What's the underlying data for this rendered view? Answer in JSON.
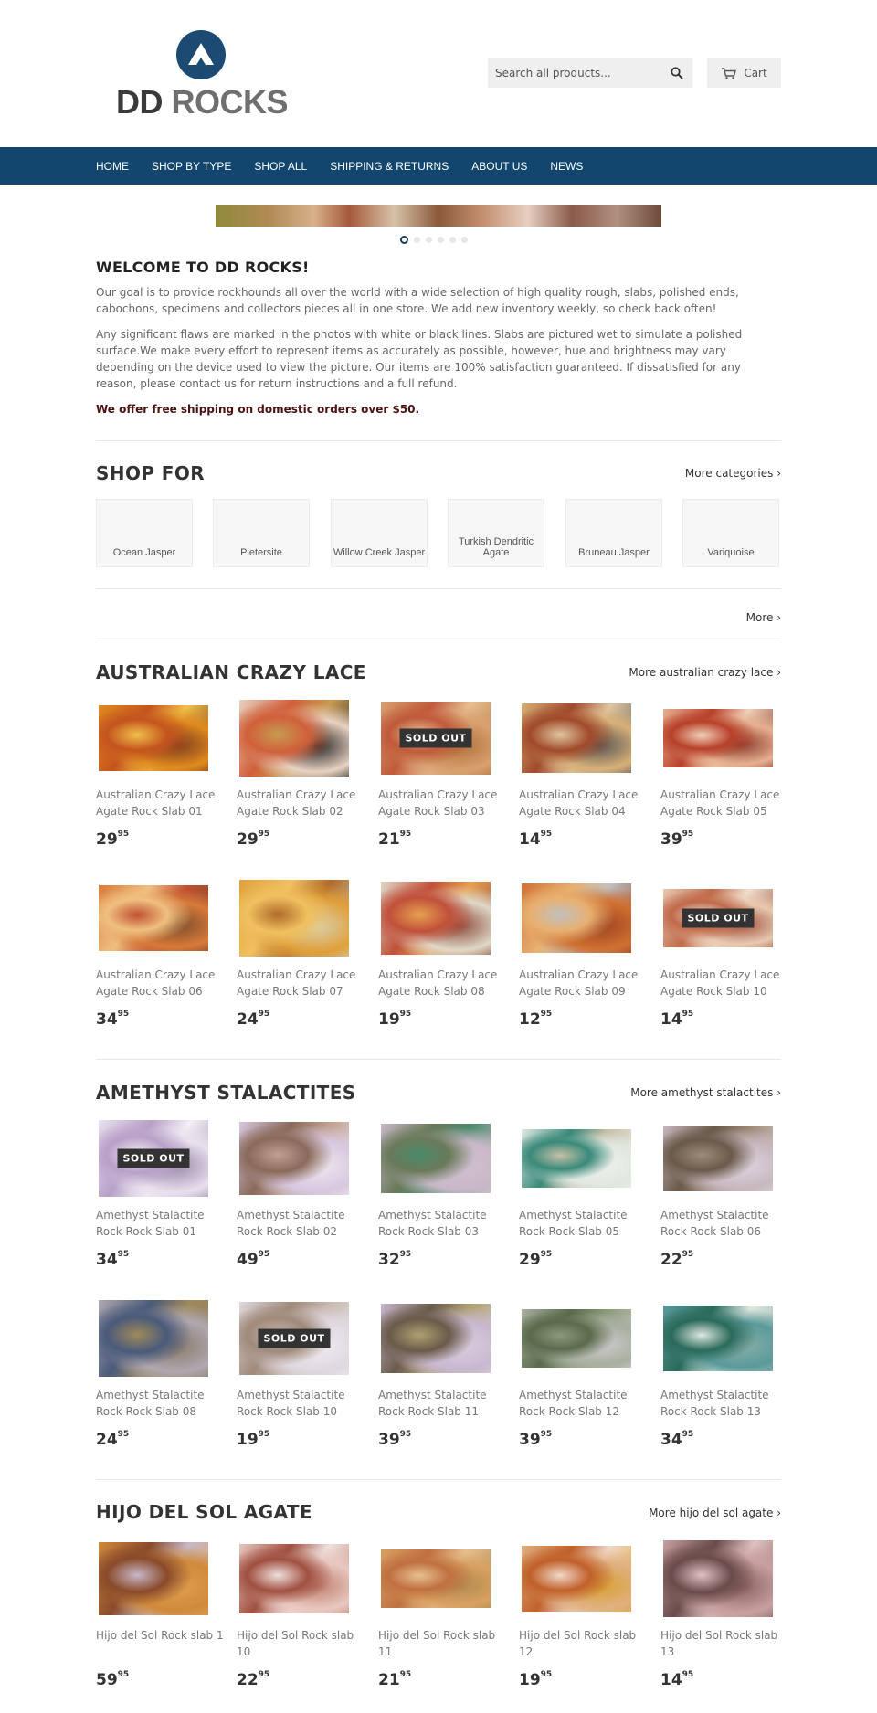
{
  "header": {
    "logo_dd": "DD",
    "logo_rocks": "ROCKS",
    "search_placeholder": "Search all products...",
    "cart_label": "Cart"
  },
  "nav": [
    "HOME",
    "SHOP BY TYPE",
    "SHOP ALL",
    "SHIPPING & RETURNS",
    "ABOUT US",
    "NEWS"
  ],
  "slideshow": {
    "slides": 6,
    "active": 1
  },
  "welcome": {
    "title": "WELCOME TO DD ROCKS!",
    "p1": "Our goal is to provide rockhounds all over the world with a wide selection of high quality rough, slabs, polished ends, cabochons, specimens and collectors pieces all in one store.  We add new inventory weekly, so check back often!",
    "p2": "Any significant flaws are marked in the photos with white or black lines. Slabs are pictured wet to simulate a polished surface.We make every effort to represent items as accurately as possible, however, hue and brightness may vary depending on the device used to view the picture. Our items are 100% satisfaction guaranteed. If dissatisfied for any reason, please contact us for return instructions and a full refund.",
    "free_shipping": "We offer free shipping on domestic orders over $50."
  },
  "shop_for": {
    "title": "SHOP FOR",
    "more": "More categories ›",
    "categories": [
      "Ocean Jasper",
      "Pietersite",
      "Willow Creek Jasper",
      "Turkish Dendritic Agate",
      "Bruneau Jasper",
      "Variquoise"
    ],
    "more_bottom": "More ›"
  },
  "sold_out_label": "SOLD OUT",
  "sections": [
    {
      "title": "AUSTRALIAN CRAZY LACE",
      "more": "More australian crazy lace ›",
      "products": [
        {
          "name": "Australian Crazy Lace Agate Rock Slab 01",
          "dollars": "29",
          "cents": "95",
          "sold_out": false,
          "colors": [
            "#e08a1e",
            "#c4541e",
            "#f0c04a",
            "#7a3a1e"
          ]
        },
        {
          "name": "Australian Crazy Lace Agate Rock Slab 02",
          "dollars": "29",
          "cents": "95",
          "sold_out": false,
          "colors": [
            "#e8d2c2",
            "#d0603a",
            "#c89a50",
            "#222222"
          ]
        },
        {
          "name": "Australian Crazy Lace Agate Rock Slab 03",
          "dollars": "21",
          "cents": "95",
          "sold_out": true,
          "colors": [
            "#d8a070",
            "#c05a3a",
            "#e8c090",
            "#b0703a"
          ]
        },
        {
          "name": "Australian Crazy Lace Agate Rock Slab 04",
          "dollars": "14",
          "cents": "95",
          "sold_out": false,
          "colors": [
            "#d8b078",
            "#a04a2a",
            "#e0c6a0",
            "#555555"
          ]
        },
        {
          "name": "Australian Crazy Lace Agate Rock Slab 05",
          "dollars": "39",
          "cents": "95",
          "sold_out": false,
          "colors": [
            "#e6b090",
            "#b8402a",
            "#f0d0b8",
            "#8a3a2a"
          ]
        },
        {
          "name": "Australian Crazy Lace Agate Rock Slab 06",
          "dollars": "34",
          "cents": "95",
          "sold_out": false,
          "colors": [
            "#d87a3a",
            "#f0c080",
            "#c05030",
            "#7a4a2a"
          ]
        },
        {
          "name": "Australian Crazy Lace Agate Rock Slab 07",
          "dollars": "24",
          "cents": "95",
          "sold_out": false,
          "colors": [
            "#e0a03a",
            "#f0c060",
            "#b06a2a",
            "#d8d0b0"
          ]
        },
        {
          "name": "Australian Crazy Lace Agate Rock Slab 08",
          "dollars": "19",
          "cents": "95",
          "sold_out": false,
          "colors": [
            "#e0d8c8",
            "#c0503a",
            "#e8a050",
            "#8a4a3a"
          ]
        },
        {
          "name": "Australian Crazy Lace Agate Rock Slab 09",
          "dollars": "12",
          "cents": "95",
          "sold_out": false,
          "colors": [
            "#d07030",
            "#e8b070",
            "#c0c0c0",
            "#9a4020"
          ]
        },
        {
          "name": "Australian Crazy Lace Agate Rock Slab 10",
          "dollars": "14",
          "cents": "95",
          "sold_out": true,
          "colors": [
            "#e8c8b0",
            "#c06a4a",
            "#f0e0d0",
            "#a0503a"
          ]
        }
      ]
    },
    {
      "title": "AMETHYST STALACTITES",
      "more": "More amethyst stalactites ›",
      "products": [
        {
          "name": "Amethyst Stalactite Rock Rock Slab 01",
          "dollars": "34",
          "cents": "95",
          "sold_out": true,
          "colors": [
            "#e8e0ee",
            "#b8a0c8",
            "#f4f0f6",
            "#9a88aa"
          ]
        },
        {
          "name": "Amethyst Stalactite Rock Rock Slab 02",
          "dollars": "49",
          "cents": "95",
          "sold_out": false,
          "colors": [
            "#d8c8e0",
            "#8a6a5a",
            "#c0a090",
            "#f0e8f0"
          ]
        },
        {
          "name": "Amethyst Stalactite Rock Rock Slab 03",
          "dollars": "32",
          "cents": "95",
          "sold_out": false,
          "colors": [
            "#c8b8c8",
            "#6a7a5a",
            "#4a8a6a",
            "#d0c0d0"
          ]
        },
        {
          "name": "Amethyst Stalactite Rock Rock Slab 05",
          "dollars": "29",
          "cents": "95",
          "sold_out": false,
          "colors": [
            "#e0e8e0",
            "#3a8a7a",
            "#c8c0a8",
            "#f0f0ec"
          ]
        },
        {
          "name": "Amethyst Stalactite Rock Rock Slab 06",
          "dollars": "22",
          "cents": "95",
          "sold_out": false,
          "colors": [
            "#c8b8c0",
            "#6a5a4a",
            "#a08a7a",
            "#e0d8e0"
          ]
        },
        {
          "name": "Amethyst Stalactite Rock Rock Slab 08",
          "dollars": "24",
          "cents": "95",
          "sold_out": false,
          "colors": [
            "#b0a8b0",
            "#4a5a7a",
            "#a08a5a",
            "#8a7a6a"
          ]
        },
        {
          "name": "Amethyst Stalactite Rock Rock Slab 10",
          "dollars": "19",
          "cents": "95",
          "sold_out": true,
          "colors": [
            "#e0d8e0",
            "#a08a7a",
            "#c8b8b0",
            "#f0ecf0"
          ]
        },
        {
          "name": "Amethyst Stalactite Rock Rock Slab 11",
          "dollars": "39",
          "cents": "95",
          "sold_out": false,
          "colors": [
            "#c8b8d0",
            "#6a5a4a",
            "#b0a070",
            "#dcd0e0"
          ]
        },
        {
          "name": "Amethyst Stalactite Rock Rock Slab 12",
          "dollars": "39",
          "cents": "95",
          "sold_out": false,
          "colors": [
            "#a8b0a0",
            "#5a6a4a",
            "#8a9a7a",
            "#d0ccd0"
          ]
        },
        {
          "name": "Amethyst Stalactite Rock Rock Slab 13",
          "dollars": "34",
          "cents": "95",
          "sold_out": false,
          "colors": [
            "#5a9a9a",
            "#2a6a5a",
            "#e0e8e0",
            "#8ab0a8"
          ]
        }
      ]
    },
    {
      "title": "HIJO DEL SOL AGATE",
      "more": "More hijo del sol agate ›",
      "products": [
        {
          "name": "Hijo del Sol Rock slab 1",
          "dollars": "59",
          "cents": "95",
          "sold_out": false,
          "colors": [
            "#d08a3a",
            "#8a4a2a",
            "#c8b8c8",
            "#e0a050"
          ]
        },
        {
          "name": "Hijo del Sol Rock slab 10",
          "dollars": "22",
          "cents": "95",
          "sold_out": false,
          "colors": [
            "#e8c8c0",
            "#a05040",
            "#f0e0dc",
            "#c08070"
          ]
        },
        {
          "name": "Hijo del Sol Rock slab 11",
          "dollars": "21",
          "cents": "95",
          "sold_out": false,
          "colors": [
            "#d8a060",
            "#c07040",
            "#e8c090",
            "#b08a50"
          ]
        },
        {
          "name": "Hijo del Sol Rock slab 12",
          "dollars": "19",
          "cents": "95",
          "sold_out": false,
          "colors": [
            "#e0b080",
            "#c0602a",
            "#f0d8c8",
            "#d8a030"
          ]
        },
        {
          "name": "Hijo del Sol Rock slab 13",
          "dollars": "14",
          "cents": "95",
          "sold_out": false,
          "colors": [
            "#c8a0a0",
            "#6a4a4a",
            "#e0c0c0",
            "#8a6060"
          ]
        }
      ]
    }
  ]
}
